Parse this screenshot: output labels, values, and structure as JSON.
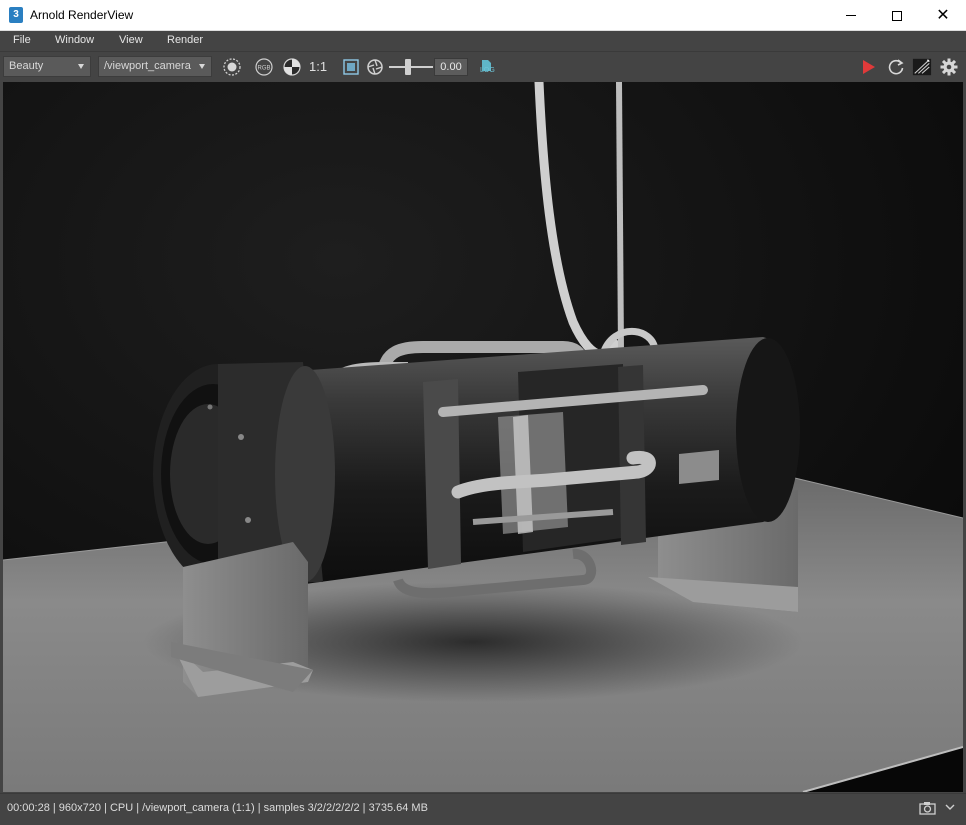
{
  "window": {
    "title": "Arnold RenderView",
    "app_icon_glyph": "3"
  },
  "menu": {
    "items": [
      "File",
      "Window",
      "View",
      "Render"
    ]
  },
  "toolbar": {
    "aov_value": "Beauty",
    "camera_value": "/viewport_camera",
    "ratio_label": "1:1",
    "exposure_value": "0.00",
    "log_label": "LOG",
    "icons": [
      "display-settings-icon",
      "rgb-channels-icon",
      "checker-background-icon",
      "region-crop-icon",
      "exposure-icon",
      "render-play-icon",
      "refresh-icon",
      "debug-shading-icon",
      "settings-gear-icon"
    ],
    "play_color": "#e03a3a"
  },
  "viewport": {
    "description_icon": "render-image"
  },
  "status": {
    "text": "00:00:28 | 960x720 | CPU | /viewport_camera (1:1) | samples 3/2/2/2/2/2 | 3735.64 MB"
  },
  "colors": {
    "chrome": "#444444",
    "titlebar": "#ffffff",
    "accent": "#6fc3d6"
  }
}
